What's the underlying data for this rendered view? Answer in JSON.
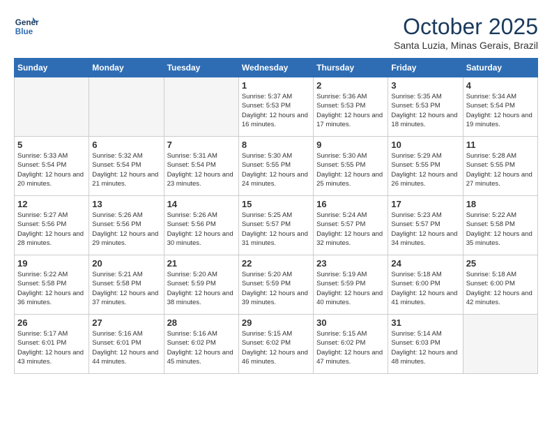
{
  "logo": {
    "line1": "General",
    "line2": "Blue"
  },
  "title": "October 2025",
  "subtitle": "Santa Luzia, Minas Gerais, Brazil",
  "weekdays": [
    "Sunday",
    "Monday",
    "Tuesday",
    "Wednesday",
    "Thursday",
    "Friday",
    "Saturday"
  ],
  "weeks": [
    [
      {
        "day": "",
        "info": ""
      },
      {
        "day": "",
        "info": ""
      },
      {
        "day": "",
        "info": ""
      },
      {
        "day": "1",
        "info": "Sunrise: 5:37 AM\nSunset: 5:53 PM\nDaylight: 12 hours\nand 16 minutes."
      },
      {
        "day": "2",
        "info": "Sunrise: 5:36 AM\nSunset: 5:53 PM\nDaylight: 12 hours\nand 17 minutes."
      },
      {
        "day": "3",
        "info": "Sunrise: 5:35 AM\nSunset: 5:53 PM\nDaylight: 12 hours\nand 18 minutes."
      },
      {
        "day": "4",
        "info": "Sunrise: 5:34 AM\nSunset: 5:54 PM\nDaylight: 12 hours\nand 19 minutes."
      }
    ],
    [
      {
        "day": "5",
        "info": "Sunrise: 5:33 AM\nSunset: 5:54 PM\nDaylight: 12 hours\nand 20 minutes."
      },
      {
        "day": "6",
        "info": "Sunrise: 5:32 AM\nSunset: 5:54 PM\nDaylight: 12 hours\nand 21 minutes."
      },
      {
        "day": "7",
        "info": "Sunrise: 5:31 AM\nSunset: 5:54 PM\nDaylight: 12 hours\nand 23 minutes."
      },
      {
        "day": "8",
        "info": "Sunrise: 5:30 AM\nSunset: 5:55 PM\nDaylight: 12 hours\nand 24 minutes."
      },
      {
        "day": "9",
        "info": "Sunrise: 5:30 AM\nSunset: 5:55 PM\nDaylight: 12 hours\nand 25 minutes."
      },
      {
        "day": "10",
        "info": "Sunrise: 5:29 AM\nSunset: 5:55 PM\nDaylight: 12 hours\nand 26 minutes."
      },
      {
        "day": "11",
        "info": "Sunrise: 5:28 AM\nSunset: 5:55 PM\nDaylight: 12 hours\nand 27 minutes."
      }
    ],
    [
      {
        "day": "12",
        "info": "Sunrise: 5:27 AM\nSunset: 5:56 PM\nDaylight: 12 hours\nand 28 minutes."
      },
      {
        "day": "13",
        "info": "Sunrise: 5:26 AM\nSunset: 5:56 PM\nDaylight: 12 hours\nand 29 minutes."
      },
      {
        "day": "14",
        "info": "Sunrise: 5:26 AM\nSunset: 5:56 PM\nDaylight: 12 hours\nand 30 minutes."
      },
      {
        "day": "15",
        "info": "Sunrise: 5:25 AM\nSunset: 5:57 PM\nDaylight: 12 hours\nand 31 minutes."
      },
      {
        "day": "16",
        "info": "Sunrise: 5:24 AM\nSunset: 5:57 PM\nDaylight: 12 hours\nand 32 minutes."
      },
      {
        "day": "17",
        "info": "Sunrise: 5:23 AM\nSunset: 5:57 PM\nDaylight: 12 hours\nand 34 minutes."
      },
      {
        "day": "18",
        "info": "Sunrise: 5:22 AM\nSunset: 5:58 PM\nDaylight: 12 hours\nand 35 minutes."
      }
    ],
    [
      {
        "day": "19",
        "info": "Sunrise: 5:22 AM\nSunset: 5:58 PM\nDaylight: 12 hours\nand 36 minutes."
      },
      {
        "day": "20",
        "info": "Sunrise: 5:21 AM\nSunset: 5:58 PM\nDaylight: 12 hours\nand 37 minutes."
      },
      {
        "day": "21",
        "info": "Sunrise: 5:20 AM\nSunset: 5:59 PM\nDaylight: 12 hours\nand 38 minutes."
      },
      {
        "day": "22",
        "info": "Sunrise: 5:20 AM\nSunset: 5:59 PM\nDaylight: 12 hours\nand 39 minutes."
      },
      {
        "day": "23",
        "info": "Sunrise: 5:19 AM\nSunset: 5:59 PM\nDaylight: 12 hours\nand 40 minutes."
      },
      {
        "day": "24",
        "info": "Sunrise: 5:18 AM\nSunset: 6:00 PM\nDaylight: 12 hours\nand 41 minutes."
      },
      {
        "day": "25",
        "info": "Sunrise: 5:18 AM\nSunset: 6:00 PM\nDaylight: 12 hours\nand 42 minutes."
      }
    ],
    [
      {
        "day": "26",
        "info": "Sunrise: 5:17 AM\nSunset: 6:01 PM\nDaylight: 12 hours\nand 43 minutes."
      },
      {
        "day": "27",
        "info": "Sunrise: 5:16 AM\nSunset: 6:01 PM\nDaylight: 12 hours\nand 44 minutes."
      },
      {
        "day": "28",
        "info": "Sunrise: 5:16 AM\nSunset: 6:02 PM\nDaylight: 12 hours\nand 45 minutes."
      },
      {
        "day": "29",
        "info": "Sunrise: 5:15 AM\nSunset: 6:02 PM\nDaylight: 12 hours\nand 46 minutes."
      },
      {
        "day": "30",
        "info": "Sunrise: 5:15 AM\nSunset: 6:02 PM\nDaylight: 12 hours\nand 47 minutes."
      },
      {
        "day": "31",
        "info": "Sunrise: 5:14 AM\nSunset: 6:03 PM\nDaylight: 12 hours\nand 48 minutes."
      },
      {
        "day": "",
        "info": ""
      }
    ]
  ]
}
